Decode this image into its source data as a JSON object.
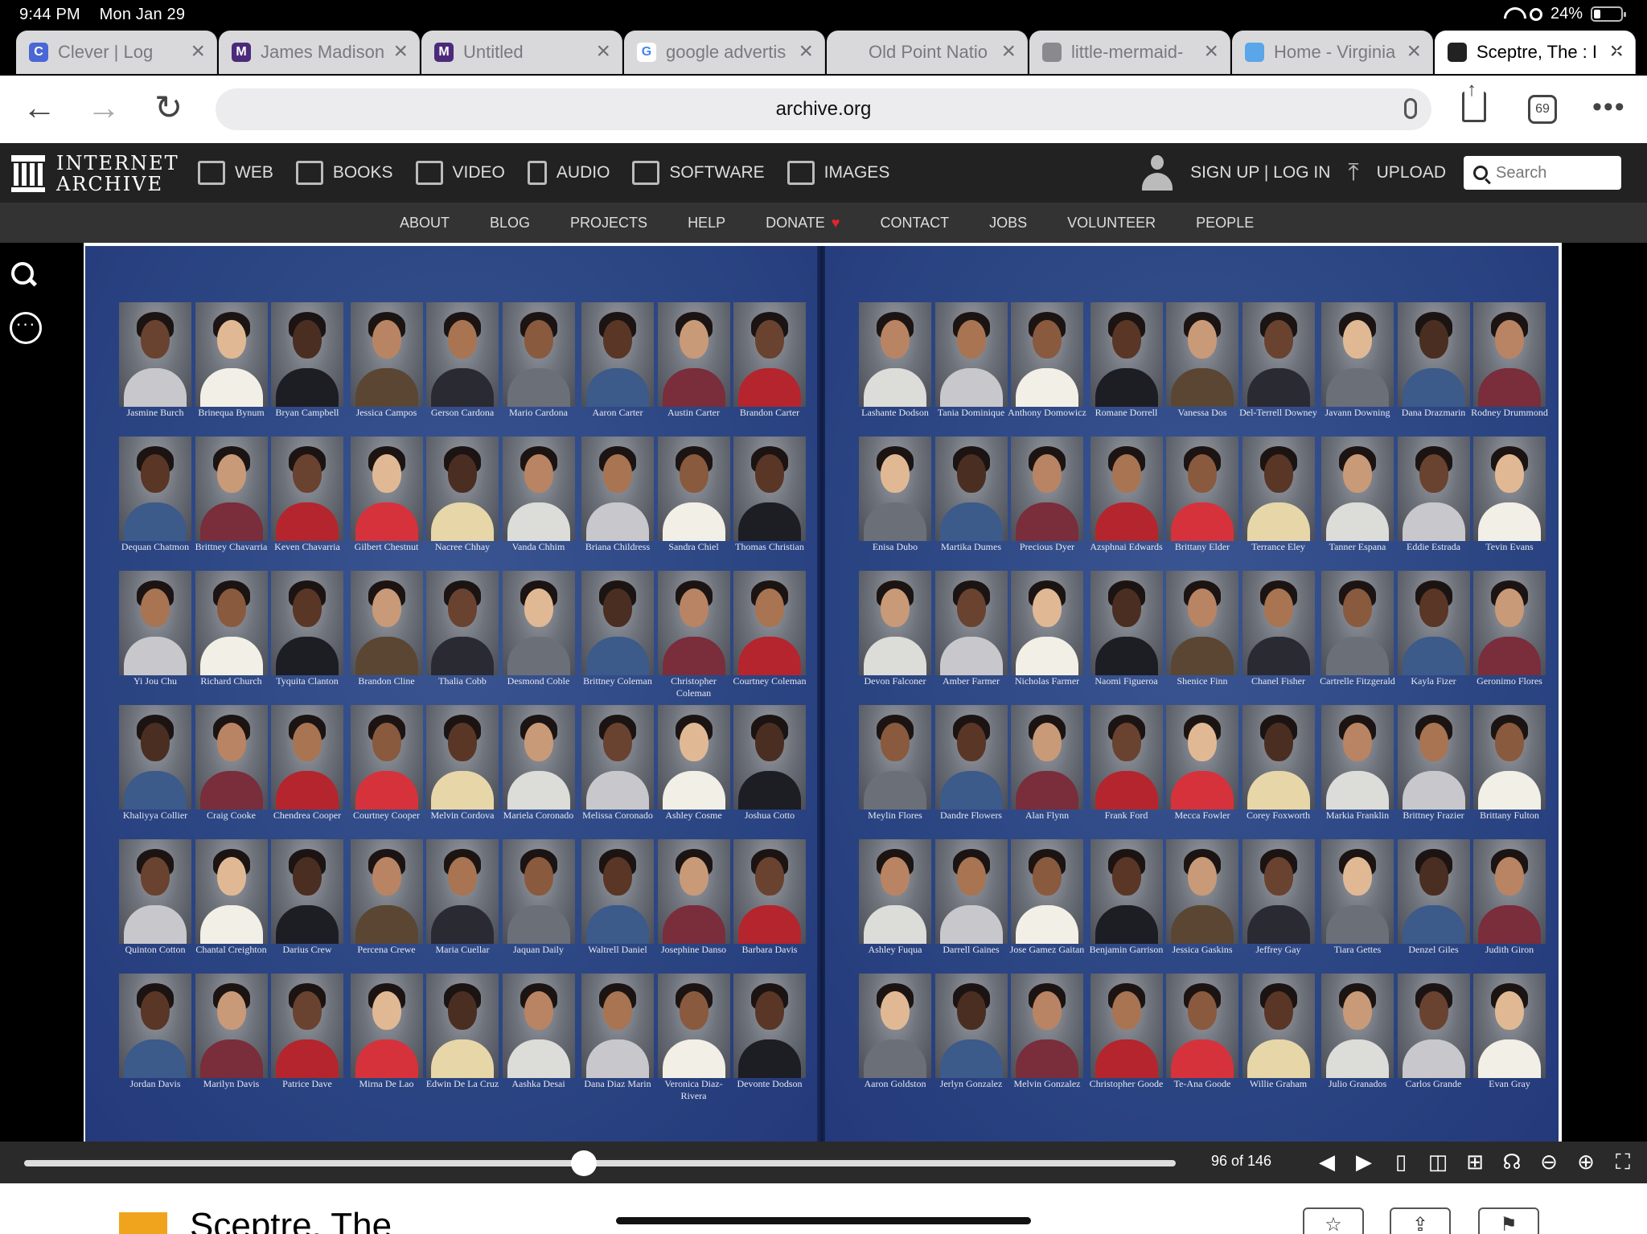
{
  "status": {
    "time": "9:44 PM",
    "date": "Mon Jan 29",
    "battery": "24%",
    "battery_level": 0.24
  },
  "tabs": [
    {
      "title": "Clever | Log",
      "icon": "clever-icon",
      "fav": "C",
      "favcolor": "#4a67d6"
    },
    {
      "title": "James Madison",
      "icon": "jmu-icon",
      "fav": "M",
      "favcolor": "#4b2a7a"
    },
    {
      "title": "Untitled",
      "icon": "jmu-icon",
      "fav": "M",
      "favcolor": "#4b2a7a"
    },
    {
      "title": "google advertis",
      "icon": "google-icon",
      "fav": "G",
      "favcolor": "#ffffff"
    },
    {
      "title": "Old Point Natio",
      "icon": "document-icon",
      "fav": "",
      "favcolor": "#d9d9dc"
    },
    {
      "title": "little-mermaid-",
      "icon": "globe-icon",
      "fav": "",
      "favcolor": "#8a8a8e"
    },
    {
      "title": "Home - Virginia",
      "icon": "cloud-icon",
      "fav": "",
      "favcolor": "#5aa6e8"
    },
    {
      "title": "Sceptre, The : I",
      "icon": "archive-icon",
      "fav": "",
      "favcolor": "#222222"
    }
  ],
  "address": {
    "url": "archive.org",
    "tab_count": "69"
  },
  "ia": {
    "logo_line1": "INTERNET",
    "logo_line2": "ARCHIVE",
    "nav": [
      "WEB",
      "BOOKS",
      "VIDEO",
      "AUDIO",
      "SOFTWARE",
      "IMAGES"
    ],
    "signup": "SIGN UP | LOG IN",
    "upload": "UPLOAD",
    "search_placeholder": "Search",
    "subnav": [
      "ABOUT",
      "BLOG",
      "PROJECTS",
      "HELP",
      "DONATE",
      "CONTACT",
      "JOBS",
      "VOLUNTEER",
      "PEOPLE"
    ]
  },
  "left_page_names": [
    "Jasmine Burch",
    "Brinequa Bynum",
    "Bryan Campbell",
    "Jessica Campos",
    "Gerson Cardona",
    "Mario Cardona",
    "Aaron Carter",
    "Austin Carter",
    "Brandon Carter",
    "Dequan Chatmon",
    "Brittney Chavarria",
    "Keven Chavarria",
    "Gilbert Chestnut",
    "Nacree Chhay",
    "Vanda Chhim",
    "Briana Childress",
    "Sandra Chiel",
    "Thomas Christian",
    "Yi Jou Chu",
    "Richard Church",
    "Tyquita Clanton",
    "Brandon Cline",
    "Thalia Cobb",
    "Desmond Coble",
    "Brittney Coleman",
    "Christopher Coleman",
    "Courtney Coleman",
    "Khaliyya Collier",
    "Craig Cooke",
    "Chendrea Cooper",
    "Courtney Cooper",
    "Melvin Cordova",
    "Mariela Coronado",
    "Melissa Coronado",
    "Ashley Cosme",
    "Joshua Cotto",
    "Quinton Cotton",
    "Chantal Creighton",
    "Darius Crew",
    "Percena Crewe",
    "Maria Cuellar",
    "Jaquan Daily",
    "Waltrell Daniel",
    "Josephine Danso",
    "Barbara Davis",
    "Jordan Davis",
    "Marilyn Davis",
    "Patrice Dave",
    "Mirna De Lao",
    "Edwin De La Cruz",
    "Aashka Desai",
    "Dana Diaz Marin",
    "Veronica Diaz-Rivera",
    "Devonte Dodson"
  ],
  "right_page_names": [
    "Lashante Dodson",
    "Tania Dominique",
    "Anthony Domowicz",
    "Romane Dorrell",
    "Vanessa Dos",
    "Del-Terrell Downey",
    "Javann Downing",
    "Dana Drazmarin",
    "Rodney Drummond",
    "Enisa Dubo",
    "Martika Dumes",
    "Precious Dyer",
    "Azsphnai Edwards",
    "Brittany Elder",
    "Terrance Eley",
    "Tanner Espana",
    "Eddie Estrada",
    "Tevin Evans",
    "Devon Falconer",
    "Amber Farmer",
    "Nicholas Farmer",
    "Naomi Figueroa",
    "Shenice Finn",
    "Chanel Fisher",
    "Cartrelle Fitzgerald",
    "Kayla Fizer",
    "Geronimo Flores",
    "Meylin Flores",
    "Dandre Flowers",
    "Alan Flynn",
    "Frank Ford",
    "Mecca Fowler",
    "Corey Foxworth",
    "Markia Franklin",
    "Brittney Frazier",
    "Brittany Fulton",
    "Ashley Fuqua",
    "Darrell Gaines",
    "Jose Gamez Gaitan",
    "Benjamin Garrison",
    "Jessica Gaskins",
    "Jeffrey Gay",
    "Tiara Gettes",
    "Denzel Giles",
    "Judith Giron",
    "Aaron Goldston",
    "Jerlyn Gonzalez",
    "Melvin Gonzalez",
    "Christopher Goode",
    "Te-Ana Goode",
    "Willie Graham",
    "Julio Granados",
    "Carlos Grande",
    "Evan Gray"
  ],
  "player": {
    "page_indicator": "96 of 146",
    "progress": 0.486
  },
  "below": {
    "title": "Sceptre, The"
  }
}
